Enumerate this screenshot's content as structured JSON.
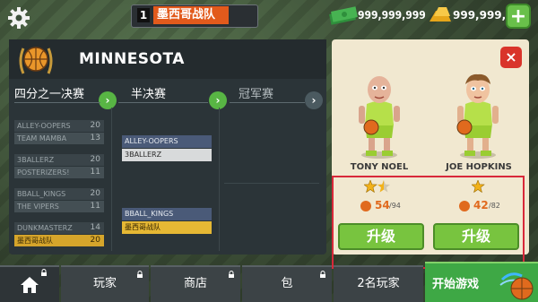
{
  "top_bar": {
    "rank_number": "1",
    "rank_team": "墨西哥战队",
    "cash": "999,999,999",
    "gold": "999,999,9",
    "plus_label": "+"
  },
  "bracket": {
    "team_name": "MINNESOTA",
    "rounds": [
      "四分之一决赛",
      "半决赛",
      "冠军赛"
    ],
    "quarterfinals": [
      {
        "name": "ALLEY-OOPERS",
        "score": "20"
      },
      {
        "name": "TEAM MAMBA",
        "score": "13"
      },
      {
        "name": "3BALLERZ",
        "score": "20"
      },
      {
        "name": "POSTERIZERS!",
        "score": "11"
      },
      {
        "name": "BBALL_KINGS",
        "score": "20"
      },
      {
        "name": "THE VIPERS",
        "score": "11"
      },
      {
        "name": "DUNKMASTERZ",
        "score": "14"
      },
      {
        "name": "墨西哥战队",
        "score": "20"
      }
    ],
    "semifinals": [
      {
        "name": "ALLEY-OOPERS"
      },
      {
        "name": "3BALLERZ"
      },
      {
        "name": "BBALL_KINGS"
      },
      {
        "name": "墨西哥战队"
      }
    ]
  },
  "players": [
    {
      "name": "TONY NOEL",
      "stars": 1.5,
      "stat": "54",
      "max": "/94",
      "button": "升级"
    },
    {
      "name": "JOE HOPKINS",
      "stars": 1,
      "stat": "42",
      "max": "/82",
      "button": "升级"
    }
  ],
  "close_label": "×",
  "nav": {
    "players": "玩家",
    "store": "商店",
    "bag": "包",
    "two_players": "2名玩家",
    "start": "开始游戏"
  },
  "colors": {
    "accent_orange": "#e25a1c",
    "upgrade_green": "#78c43f",
    "highlight_red": "#d8283a",
    "start_green": "#3ea845"
  },
  "icons": [
    "gear-icon",
    "cash-icon",
    "gold-bars-icon",
    "plus-icon",
    "basketball-emblem-icon",
    "arrow-right-icon",
    "close-icon",
    "star-icon",
    "basketball-icon",
    "home-icon",
    "lock-icon"
  ]
}
